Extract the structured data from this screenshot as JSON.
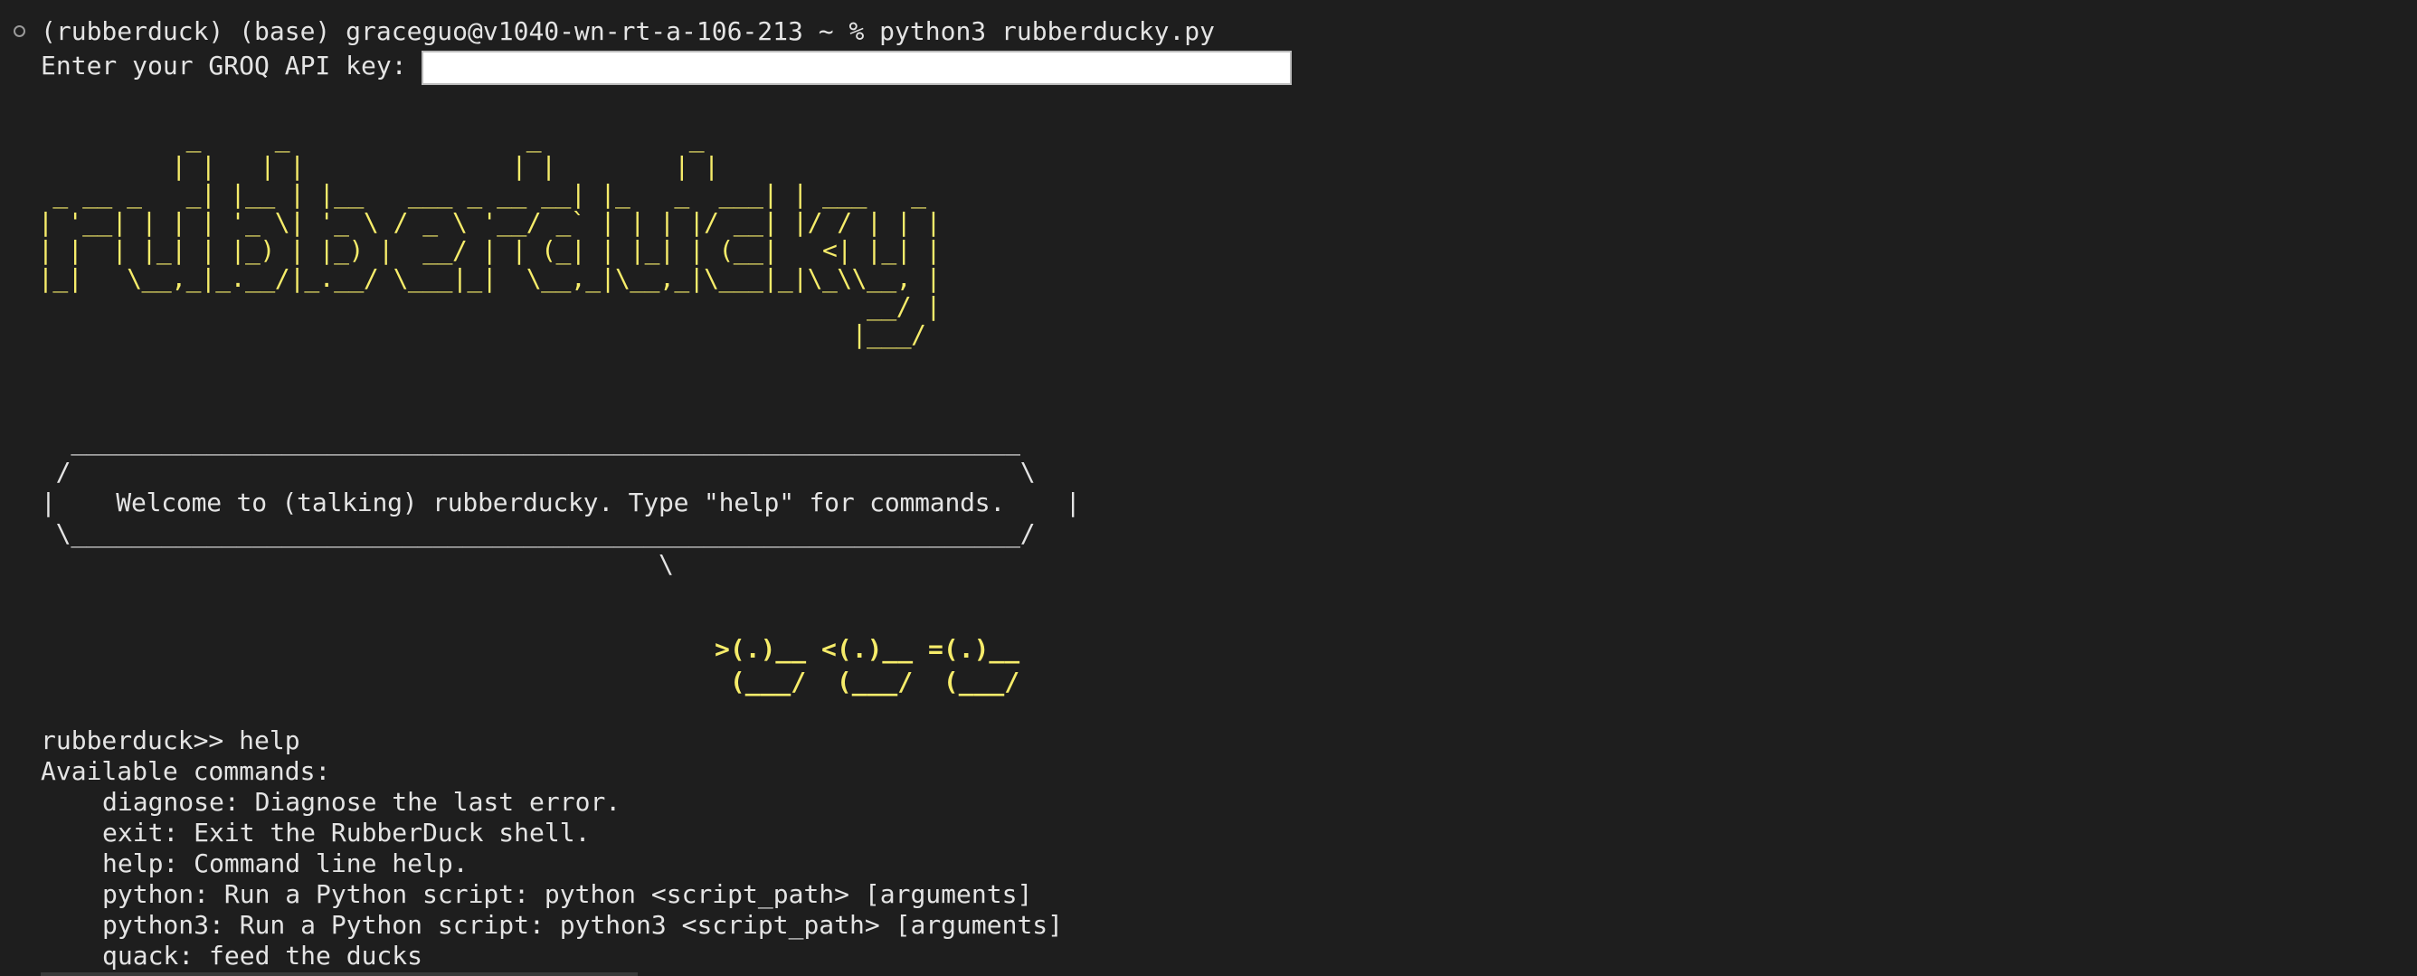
{
  "terminal": {
    "prompt_line": "(rubberduck) (base) graceguo@v1040-wn-rt-a-106-213 ~ % python3 rubberducky.py",
    "api_key_label": "Enter your GROQ API key: ",
    "api_key_value": "",
    "banner_ascii": "          _     _                _          _\n         | |   | |              | |        | |\n _ __ _   _| |__ | |__   ___ _ __ __| |_   _  ___| | ___   _\n| '__| | | | '_ \\| '_ \\ / _ \\ '__/ _` | | | |/ __| |/ / | | |\n| |  | |_| | |_) | |_) |  __/ | | (_| | |_| | (__|   <| |_| |\n|_|   \\__,_|_.__/|_.__/ \\___|_|  \\__,_|\\__,_|\\___|_|\\_\\\\__, |\n                                                        __/ |\n                                                       |___/",
    "speech_bubble": "  _______________________________________________________________\n /                                                               \\\n|    Welcome to (talking) rubberducky. Type \"help\" for commands.    |\n \\_______________________________________________________________/\n                                         \\",
    "ducks_ascii": ">(.)__ <(.)__ =(.)__\n (___/  (___/  (___/",
    "repl_prompt": "rubberduck>> help",
    "help_header": "Available commands:",
    "commands": [
      "diagnose: Diagnose the last error.",
      "exit: Exit the RubberDuck shell.",
      "help: Command line help.",
      "python: Run a Python script: python <script_path> [arguments]",
      "python3: Run a Python script: python3 <script_path> [arguments]",
      "quack: feed the ducks"
    ]
  },
  "colors": {
    "background": "#1e1e1e",
    "text": "#e4e4e4",
    "ascii_yellow": "#f6ec6a"
  }
}
